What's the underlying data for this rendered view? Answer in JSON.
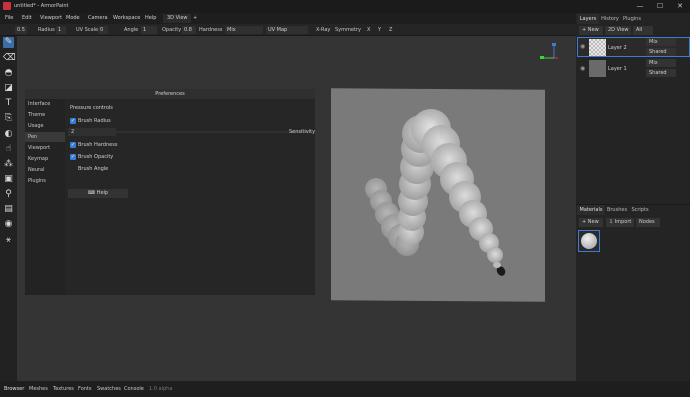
{
  "window": {
    "title": "untitled* - ArmorPaint",
    "controls": [
      "—",
      "☐",
      "✕"
    ]
  },
  "menu": {
    "items": [
      "File",
      "Edit",
      "Viewport",
      "Mode",
      "Camera",
      "Workspace",
      "Help"
    ],
    "view_tab": "3D View",
    "add_tab": "+"
  },
  "toolbar": {
    "size_value": "0.5",
    "radius_label": "Radius",
    "radius_value": "1",
    "uvscale_label": "UV Scale",
    "uvscale_value": "0",
    "angle_label": "Angle",
    "angle_value": "1",
    "opacity_label": "Opacity",
    "opacity_value": "0.8",
    "hardness_label": "Hardness",
    "blend_value": "Mix",
    "uvmap_value": "UV Map",
    "xray_label": "X-Ray",
    "symmetry_label": "Symmetry",
    "x_label": "X",
    "y_label": "Y",
    "z_label": "Z"
  },
  "tools": [
    "brush-icon",
    "eraser-icon",
    "fill-icon",
    "decal-icon",
    "text-icon",
    "clone-icon",
    "blur-icon",
    "smudge-icon",
    "particle-icon",
    "colorid-icon",
    "picker-icon",
    "bake-icon",
    "material-icon",
    "gizmo-icon"
  ],
  "preferences": {
    "title": "Preferences",
    "nav": [
      "Interface",
      "Theme",
      "Usage",
      "Pen",
      "Viewport",
      "Keymap",
      "Neural",
      "Plugins"
    ],
    "active_nav": "Pen",
    "section_title": "Pressure controls",
    "brush_radius": "Brush Radius",
    "sensitivity_value": "2",
    "sensitivity_label": "Sensitivity",
    "brush_hardness": "Brush Hardness",
    "brush_opacity": "Brush Opacity",
    "brush_angle": "Brush Angle",
    "help_button": "Help"
  },
  "layers_panel": {
    "tabs": [
      "Layers",
      "History",
      "Plugins"
    ],
    "new_button": "New",
    "view_select": "2D View",
    "filter_select": "All",
    "layers": [
      {
        "name": "Layer 2",
        "blend": "Mix",
        "mode": "Shared",
        "selected": true
      },
      {
        "name": "Layer 1",
        "blend": "Mix",
        "mode": "Shared",
        "selected": false
      }
    ]
  },
  "materials_panel": {
    "tabs": [
      "Materials",
      "Brushes",
      "Scripts"
    ],
    "new_button": "New",
    "import_button": "Import",
    "nodes_button": "Nodes"
  },
  "bottom_tabs": [
    "Browser",
    "Meshes",
    "Textures",
    "Fonts",
    "Swatches",
    "Console",
    "1.0 alpha"
  ],
  "colors": {
    "accent": "#3a7bd5",
    "brand": "#c8323c"
  }
}
